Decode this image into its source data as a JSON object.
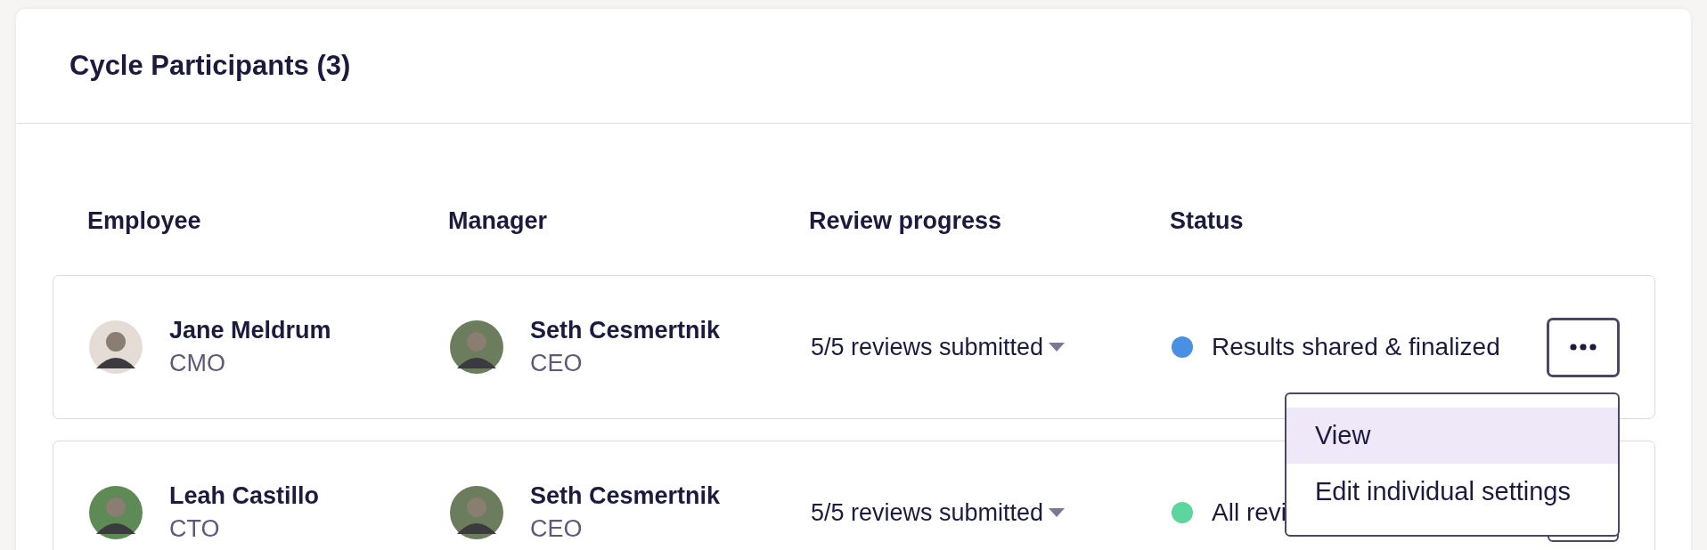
{
  "card": {
    "title": "Cycle Participants (3)"
  },
  "table": {
    "columns": [
      "Employee",
      "Manager",
      "Review progress",
      "Status"
    ],
    "rows": [
      {
        "employee": {
          "name": "Jane Meldrum",
          "role": "CMO"
        },
        "manager": {
          "name": "Seth Cesmertnik",
          "role": "CEO"
        },
        "progress": "5/5 reviews submitted",
        "status": {
          "text": "Results shared & finalized",
          "color": "#4a90e2"
        },
        "menu_open": true
      },
      {
        "employee": {
          "name": "Leah Castillo",
          "role": "CTO"
        },
        "manager": {
          "name": "Seth Cesmertnik",
          "role": "CEO"
        },
        "progress": "5/5 reviews submitted",
        "status": {
          "text": "All revi",
          "color": "#5cd69c"
        },
        "menu_open": false
      }
    ]
  },
  "menu": {
    "items": [
      {
        "label": "View",
        "selected": true
      },
      {
        "label": "Edit individual settings",
        "selected": false
      }
    ]
  }
}
